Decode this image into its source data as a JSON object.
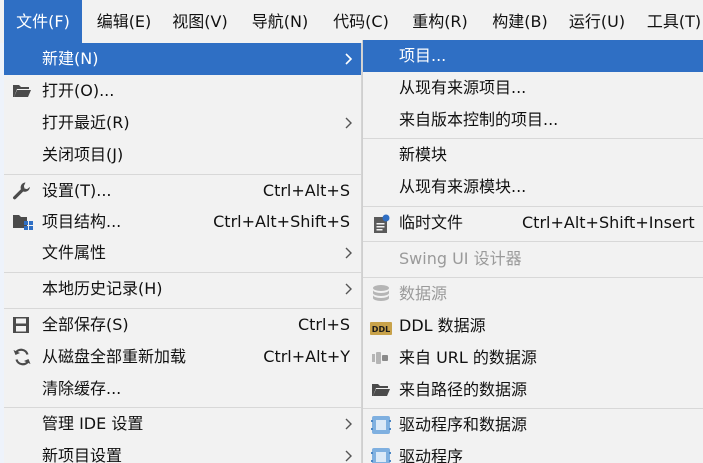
{
  "menubar": {
    "items": [
      {
        "label": "文件(F)"
      },
      {
        "label": "编辑(E)"
      },
      {
        "label": "视图(V)"
      },
      {
        "label": "导航(N)"
      },
      {
        "label": "代码(C)"
      },
      {
        "label": "重构(R)"
      },
      {
        "label": "构建(B)"
      },
      {
        "label": "运行(U)"
      },
      {
        "label": "工具(T)"
      }
    ]
  },
  "file_menu": {
    "items": [
      {
        "label": "新建(N)",
        "has_submenu": true,
        "selected": true
      },
      {
        "label": "打开(O)...",
        "icon": "folder-open-icon"
      },
      {
        "label": "打开最近(R)",
        "has_submenu": true
      },
      {
        "label": "关闭项目(J)"
      },
      {
        "label": "设置(T)...",
        "shortcut": "Ctrl+Alt+S",
        "icon": "wrench-icon"
      },
      {
        "label": "项目结构...",
        "shortcut": "Ctrl+Alt+Shift+S",
        "icon": "project-structure-icon"
      },
      {
        "label": "文件属性",
        "has_submenu": true
      },
      {
        "label": "本地历史记录(H)",
        "has_submenu": true
      },
      {
        "label": "全部保存(S)",
        "shortcut": "Ctrl+S",
        "icon": "save-icon"
      },
      {
        "label": "从磁盘全部重新加载",
        "shortcut": "Ctrl+Alt+Y",
        "icon": "reload-icon"
      },
      {
        "label": "清除缓存..."
      },
      {
        "label": "管理 IDE 设置",
        "has_submenu": true
      },
      {
        "label": "新项目设置",
        "has_submenu": true
      }
    ]
  },
  "new_submenu": {
    "items": [
      {
        "label": "项目...",
        "selected": true
      },
      {
        "label": "从现有来源项目..."
      },
      {
        "label": "来自版本控制的项目..."
      },
      {
        "label": "新模块"
      },
      {
        "label": "从现有来源模块..."
      },
      {
        "label": "临时文件",
        "shortcut": "Ctrl+Alt+Shift+Insert",
        "icon": "scratch-file-icon"
      },
      {
        "label": "Swing UI 设计器",
        "disabled": true
      },
      {
        "label": "数据源",
        "disabled": true,
        "icon": "database-icon"
      },
      {
        "label": "DDL 数据源",
        "icon": "ddl-icon"
      },
      {
        "label": "来自 URL 的数据源",
        "icon": "url-datasource-icon"
      },
      {
        "label": "来自路径的数据源",
        "icon": "folder-datasource-icon"
      },
      {
        "label": "驱动程序和数据源",
        "icon": "driver-datasource-icon"
      },
      {
        "label": "驱动程序",
        "icon": "driver-icon"
      }
    ]
  },
  "colors": {
    "selection": "#2f6fc4",
    "menu_bg": "#f2f2f2",
    "disabled_text": "#9a9a9a"
  }
}
